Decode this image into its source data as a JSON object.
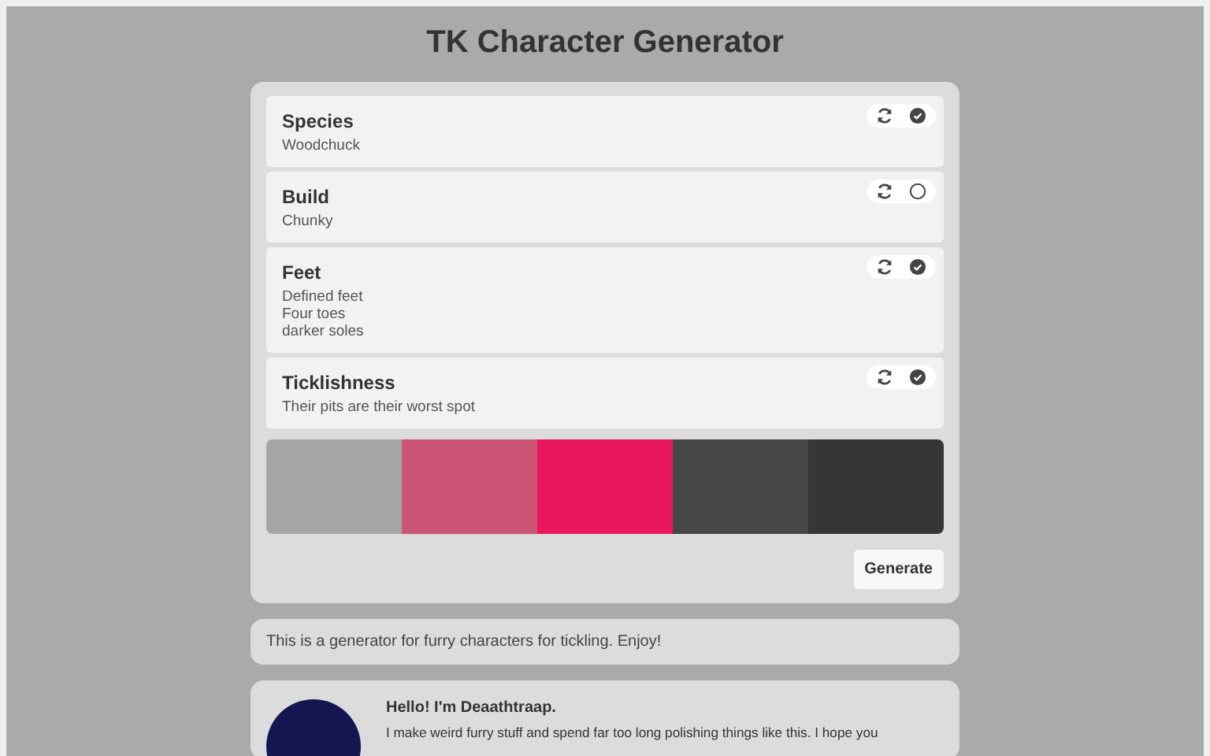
{
  "title": "TK Character Generator",
  "traits": [
    {
      "name": "Species",
      "lines": [
        "Woodchuck"
      ],
      "locked": true
    },
    {
      "name": "Build",
      "lines": [
        "Chunky"
      ],
      "locked": false
    },
    {
      "name": "Feet",
      "lines": [
        "Defined feet",
        "Four toes",
        "darker soles"
      ],
      "locked": true
    },
    {
      "name": "Ticklishness",
      "lines": [
        "Their pits are their worst spot"
      ],
      "locked": true
    }
  ],
  "palette": [
    {
      "color": "#a5a5a5"
    },
    {
      "color": "#cc5577"
    },
    {
      "color": "#e8175d"
    },
    {
      "color": "#474747"
    },
    {
      "color": "#363636"
    }
  ],
  "generate_button": "Generate",
  "info": "This is a generator for furry characters for tickling. Enjoy!",
  "author": {
    "heading": "Hello! I'm Deaathtraap.",
    "text": "I make weird furry stuff and spend far too long polishing things like this. I hope you"
  }
}
